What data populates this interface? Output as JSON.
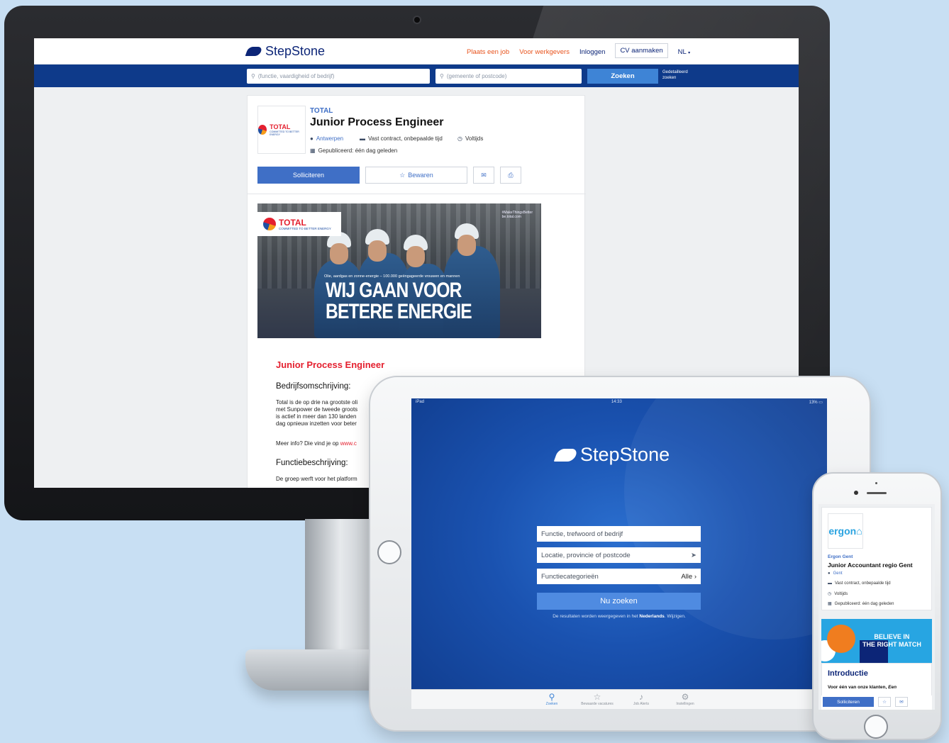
{
  "desktop": {
    "brand": "StepStone",
    "nav": {
      "post_job": "Plaats een job",
      "employers": "Voor werkgevers",
      "login": "Inloggen",
      "create_cv": "CV aanmaken",
      "language": "NL"
    },
    "search": {
      "what_placeholder": "(functie, vaardigheid of bedrijf)",
      "where_placeholder": "(gemeente of postcode)",
      "button": "Zoeken",
      "advanced_line1": "Gedetailleerd",
      "advanced_line2": "zoeken"
    },
    "job": {
      "company": "TOTAL",
      "title": "Junior Process Engineer",
      "location": "Antwerpen",
      "contract": "Vast contract, onbepaalde tijd",
      "hours": "Voltijds",
      "published": "Gepubliceerd: één dag geleden",
      "apply": "Solliciteren",
      "save": "Bewaren"
    },
    "banner": {
      "logo_word": "TOTAL",
      "logo_sub": "COMMITTED TO BETTER ENERGY",
      "tag1": "#MakeThingsBetter",
      "tag2": "be.total.com",
      "small_text": "Olie, aardgas en zonne-energie – 100.000 geëngageerde vrouwen en mannen",
      "headline1": "WIJ GAAN VOOR",
      "headline2": "BETERE ENERGIE"
    },
    "body": {
      "title": "Junior Process Engineer",
      "h_company": "Bedrijfsomschrijving:",
      "p1": "Total is de op drie na grootste oli",
      "p2": "met Sunpower de tweede groots",
      "p3": "is actief in meer dan 130 landen",
      "p4": "dag opnieuw inzetten voor beter",
      "more_info": "Meer info? Die vind je op ",
      "more_link": "www.c",
      "h_function": "Functiebeschrijving:",
      "p5": "De groep werft voor het platform"
    }
  },
  "tablet": {
    "status_left": "iPad",
    "status_time": "14:33",
    "status_battery": "13%",
    "brand": "StepStone",
    "field_what": "Functie, trefwoord of bedrijf",
    "field_where": "Locatie, provincie of postcode",
    "field_category": "Functiecategorieën",
    "category_value": "Alle",
    "search_button": "Nu zoeken",
    "note_prefix": "De resultaten worden weergegeven in het ",
    "note_lang": "Nederlands",
    "note_suffix": ". Wijzigen.",
    "tabs": [
      "Zoeken",
      "Bewaarde vacatures",
      "Job Alerts",
      "Instellingen"
    ]
  },
  "phone": {
    "logo_main": "ergon",
    "logo_accent": "⌂",
    "company": "Ergon Gent",
    "title": "Junior Accountant regio Gent",
    "location": "Gent",
    "contract": "Vast contract, onbepaalde tijd",
    "hours": "Voltijds",
    "published": "Gepubliceerd: één dag geleden",
    "banner_line1": "BELIEVE IN",
    "banner_line2": "THE RIGHT MATCH",
    "intro_title": "Introductie",
    "intro_text_prefix": "Voor één van onze klanten, ",
    "intro_text_italic": "Een",
    "apply": "Solliciteren"
  },
  "icons": {
    "search": "search-icon",
    "pin": "location-pin-icon",
    "briefcase": "briefcase-icon",
    "clock": "clock-icon",
    "calendar": "calendar-icon",
    "star": "star-icon",
    "mail": "mail-icon",
    "print": "print-icon",
    "navigate": "navigation-arrow-icon",
    "chevron": "chevron-right-icon",
    "bell": "bell-icon",
    "gear": "gear-icon"
  },
  "colors": {
    "brand_navy": "#0c2577",
    "search_bar": "#0e3a8a",
    "accent_blue": "#3f6fc6",
    "orange": "#e8541e",
    "total_red": "#e4202f"
  }
}
